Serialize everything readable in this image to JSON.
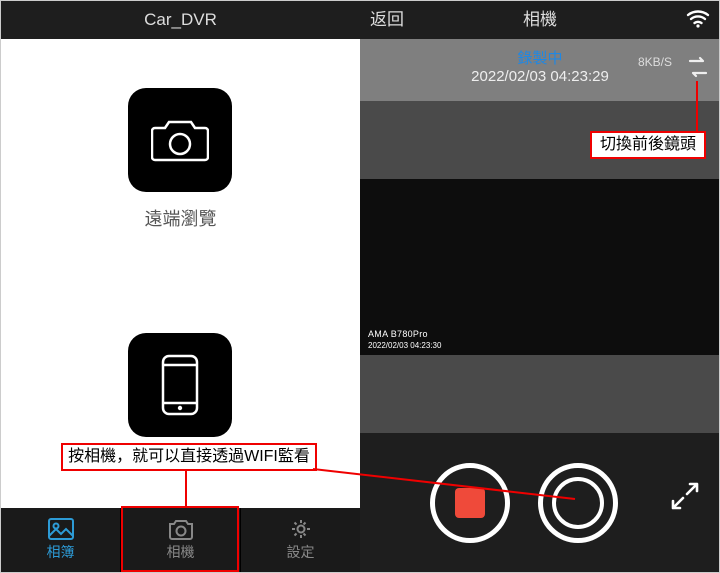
{
  "left": {
    "app_title": "Car_DVR",
    "remote_browse_label": "遠端瀏覽",
    "instruction": "按相機，就可以直接透過WIFI監看",
    "nav": {
      "album": "相簿",
      "camera": "相機",
      "settings": "設定"
    }
  },
  "right": {
    "back": "返回",
    "title": "相機",
    "recording_status": "錄製中",
    "timestamp": "2022/02/03 04:23:29",
    "bitrate": "8KB/S",
    "watermark_model": "AMA  B780Pro",
    "watermark_time": "2022/02/03 04:23:30",
    "switch_camera_callout": "切換前後鏡頭"
  },
  "icons": {
    "camera": "camera-icon",
    "phone": "phone-icon",
    "gallery": "gallery-icon",
    "gear": "gear-icon",
    "wifi": "wifi-icon",
    "swap": "switch-camera-icon",
    "fullscreen": "fullscreen-icon",
    "record_stop": "record-stop-icon",
    "shutter": "shutter-icon"
  }
}
